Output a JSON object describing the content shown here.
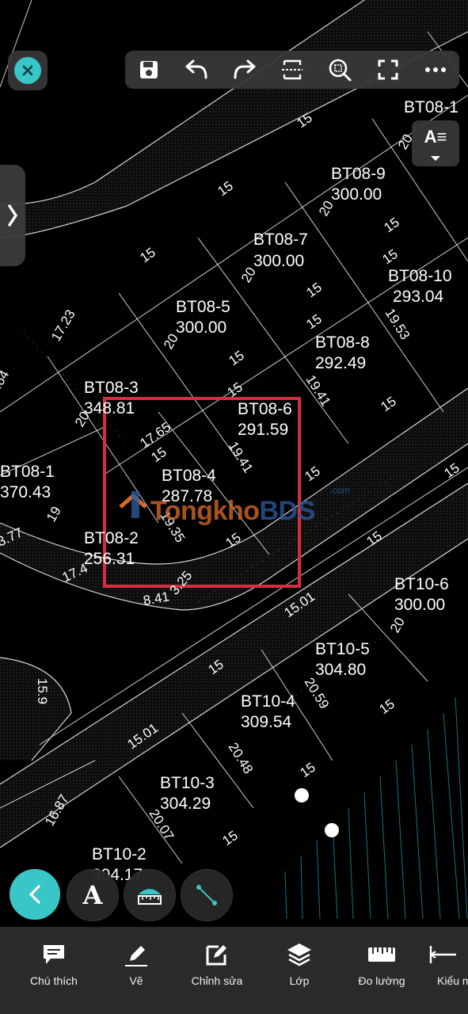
{
  "toolbar": {
    "save_icon": "save-icon",
    "undo_icon": "undo-icon",
    "redo_icon": "redo-icon",
    "split_icon": "split-icon",
    "zoom_icon": "zoom-fit-icon",
    "fullscreen_icon": "fullscreen-icon",
    "more_icon": "more-icon"
  },
  "text_style_button": {
    "label": "A≡"
  },
  "map": {
    "lots": [
      {
        "name": "BT08-1",
        "area": "370.43"
      },
      {
        "name": "BT08-3",
        "area": "348.81"
      },
      {
        "name": "BT08-5",
        "area": "300.00"
      },
      {
        "name": "BT08-7",
        "area": "300.00"
      },
      {
        "name": "BT08-9",
        "area": "300.00"
      },
      {
        "name": "BT08-2",
        "area": "256.31"
      },
      {
        "name": "BT08-4",
        "area": "287.78"
      },
      {
        "name": "BT08-6",
        "area": "291.59"
      },
      {
        "name": "BT08-8",
        "area": "292.49"
      },
      {
        "name": "BT08-10",
        "area": "293.04"
      },
      {
        "name": "BT10-2",
        "area": "304.17"
      },
      {
        "name": "BT10-3",
        "area": "304.29"
      },
      {
        "name": "BT10-4",
        "area": "309.54"
      },
      {
        "name": "BT10-5",
        "area": "304.80"
      },
      {
        "name": "BT10-6",
        "area": "300.00"
      },
      {
        "name": "BT08-1",
        "area": ""
      }
    ],
    "dimensions": [
      "15",
      "15",
      "15",
      "15",
      "15",
      "15",
      "15",
      "15",
      "15",
      "15",
      "15",
      "15",
      "15",
      "15",
      "15",
      "15",
      "15",
      "15",
      "20",
      "20",
      "20",
      "20",
      "20",
      "20",
      "17.23",
      "17.65",
      "19.41",
      "19.41",
      "19.53",
      "19",
      "17.4",
      "8.41",
      "3.25",
      "19.35",
      "15.01",
      "15.01",
      "20.59",
      "20.48",
      "20.07",
      "16.87",
      "15.9",
      "3.77",
      ".64",
      "15"
    ]
  },
  "watermark": {
    "part1": "Tongkho",
    "part2": "BDS",
    "suffix": ".com"
  },
  "bottom_nav": [
    {
      "label": "Chú thích",
      "icon": "comment-icon"
    },
    {
      "label": "Vẽ",
      "icon": "pencil-icon"
    },
    {
      "label": "Chỉnh sửa",
      "icon": "edit-icon"
    },
    {
      "label": "Lớp",
      "icon": "layers-icon"
    },
    {
      "label": "Đo lường",
      "icon": "ruler-icon"
    },
    {
      "label": "Kiểu m",
      "icon": "measure-style-icon"
    }
  ],
  "floating_tools": {
    "text_tool": "A"
  },
  "colors": {
    "accent": "#39c6c7",
    "highlight": "#d32f3f",
    "panel": "#2a2a2a"
  }
}
